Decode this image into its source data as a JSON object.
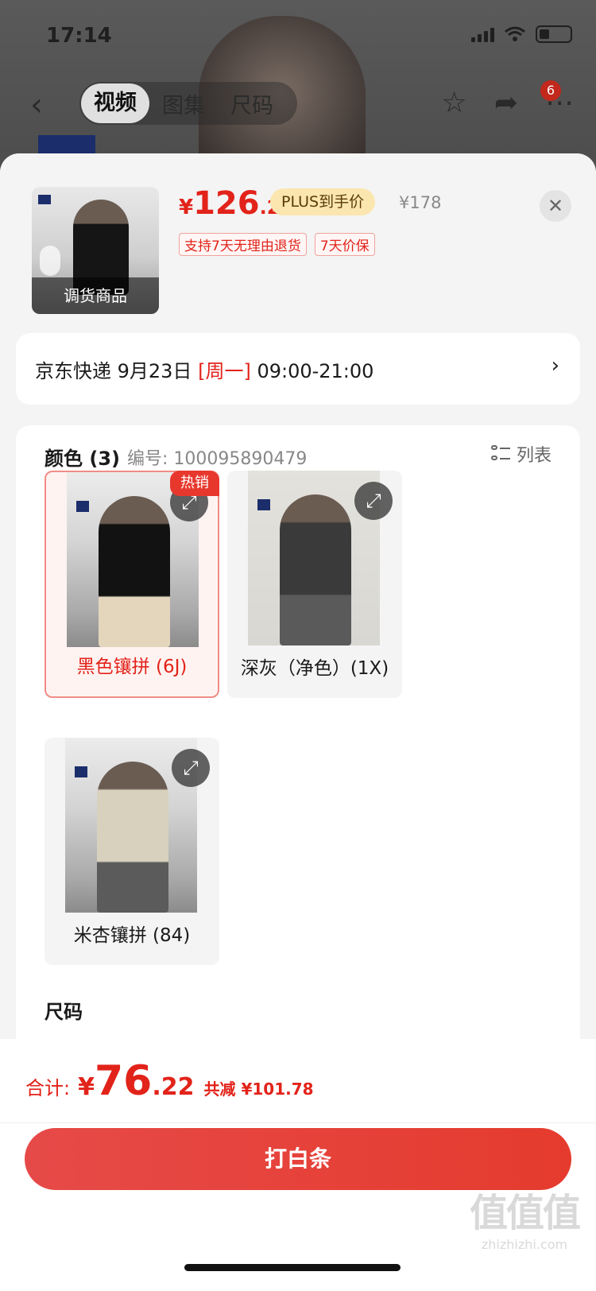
{
  "status_bar": {
    "time": "17:14"
  },
  "nav": {
    "tabs": [
      "视频",
      "图集",
      "尺码"
    ],
    "cart_badge": "6"
  },
  "product": {
    "thumb_tag": "调货商品",
    "price_yen": "¥",
    "price_int": "126",
    "price_dec": ".22",
    "plus_label": "PLUS到手价",
    "original_price": "¥178",
    "tags": [
      "支持7天无理由退货",
      "7天价保"
    ]
  },
  "delivery": {
    "prefix": "京东快递 9月23日 ",
    "weekday": "[周一]",
    "suffix": " 09:00-21:00",
    "arrow": "›"
  },
  "spec": {
    "title": "颜色 (3)",
    "sku_label": "编号: 100095890479",
    "list_label": "列表",
    "hot_badge": "热销",
    "items": [
      {
        "label": "黑色镶拼 (6J)"
      },
      {
        "label": "深灰（净色）(1X)"
      },
      {
        "label": "米杏镶拼 (84)"
      }
    ],
    "size_title": "尺码"
  },
  "footer": {
    "total_label": "合计:",
    "total_yen": "¥",
    "total_int": "76",
    "total_dec": ".22",
    "saved": "共减 ¥101.78",
    "buy_label": "打白条"
  },
  "watermark": {
    "main": "值值值",
    "sub": "zhizhizhi.com"
  },
  "colors": {
    "accent": "#e2231a",
    "plus_bg": "#fbe6b0",
    "button": "#e64a48"
  }
}
